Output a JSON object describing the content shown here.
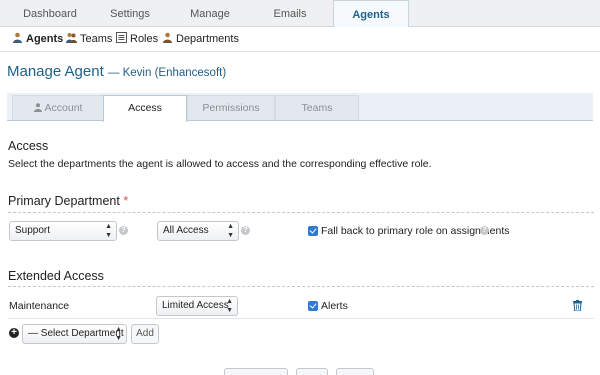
{
  "topnav": {
    "tabs": [
      {
        "label": "Dashboard"
      },
      {
        "label": "Settings"
      },
      {
        "label": "Manage"
      },
      {
        "label": "Emails"
      },
      {
        "label": "Agents",
        "active": true
      }
    ]
  },
  "subnav": {
    "items": [
      {
        "label": "Agents",
        "icon": "agent-icon",
        "active": true
      },
      {
        "label": "Teams",
        "icon": "teams-icon"
      },
      {
        "label": "Roles",
        "icon": "roles-icon"
      },
      {
        "label": "Departments",
        "icon": "departments-icon"
      }
    ]
  },
  "page": {
    "title": "Manage Agent",
    "subtitle": "— Kevin (Enhancesoft)"
  },
  "tabs": [
    {
      "label": "Account",
      "icon": "user-icon"
    },
    {
      "label": "Access",
      "active": true
    },
    {
      "label": "Permissions"
    },
    {
      "label": "Teams"
    }
  ],
  "access": {
    "heading": "Access",
    "description": "Select the departments the agent is allowed to access and the corresponding effective role."
  },
  "primary": {
    "heading": "Primary Department",
    "required_mark": "*",
    "department": "Support",
    "role": "All Access",
    "fallback_label": "Fall back to primary role on assignments",
    "fallback_checked": true
  },
  "extended": {
    "heading": "Extended Access",
    "rows": [
      {
        "department": "Maintenance",
        "role": "Limited Access",
        "alerts_label": "Alerts",
        "alerts_checked": true
      }
    ],
    "select_placeholder": "— Select Department —",
    "add_label": "Add"
  },
  "colors": {
    "accent": "#1f5f8b",
    "checkbox": "#2f7bd4",
    "required": "#d9534f"
  }
}
